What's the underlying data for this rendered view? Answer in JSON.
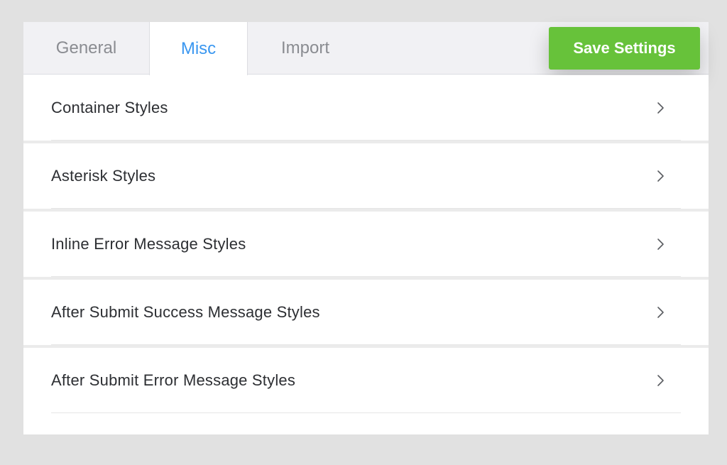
{
  "tabs": [
    {
      "label": "General",
      "active": false
    },
    {
      "label": "Misc",
      "active": true
    },
    {
      "label": "Import",
      "active": false
    }
  ],
  "save_button": {
    "label": "Save Settings",
    "color": "#67c23a"
  },
  "accent_color": "#3a97f0",
  "sections": [
    {
      "label": "Container Styles",
      "icon": "chevron-right-icon"
    },
    {
      "label": "Asterisk Styles",
      "icon": "chevron-right-icon"
    },
    {
      "label": "Inline Error Message Styles",
      "icon": "chevron-right-icon"
    },
    {
      "label": "After Submit Success Message Styles",
      "icon": "chevron-right-icon"
    },
    {
      "label": "After Submit Error Message Styles",
      "icon": "chevron-right-icon"
    }
  ]
}
